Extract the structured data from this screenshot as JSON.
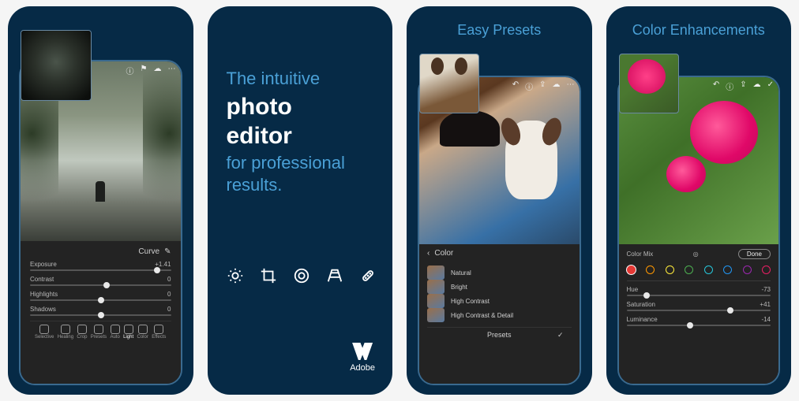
{
  "panel1": {
    "status_icons": [
      "help-icon",
      "flag-icon",
      "cloud-icon",
      "more-icon"
    ],
    "curve_label": "Curve",
    "sliders": [
      {
        "label": "Exposure",
        "value": "+1.41",
        "pos": 88
      },
      {
        "label": "Contrast",
        "value": "0",
        "pos": 52
      },
      {
        "label": "Highlights",
        "value": "0",
        "pos": 48
      },
      {
        "label": "Shadows",
        "value": "0",
        "pos": 48
      }
    ],
    "tools": [
      "Selective",
      "Healing",
      "Crop",
      "Presets",
      "Auto",
      "Light",
      "Color",
      "Effects"
    ],
    "active_tool": "Light"
  },
  "panel2": {
    "line1": "The intuitive",
    "line2": "photo",
    "line3": "editor",
    "line4": "for professional",
    "line5": "results.",
    "brand": "Adobe",
    "tool_icons": [
      "brightness-icon",
      "crop-icon",
      "lens-icon",
      "geometry-icon",
      "healing-icon"
    ]
  },
  "panel3": {
    "title": "Easy Presets",
    "back_label": "Color",
    "presets": [
      "Natural",
      "Bright",
      "High Contrast",
      "High Contrast & Detail"
    ],
    "footer": "Presets"
  },
  "panel4": {
    "title": "Color Enhancements",
    "section": "Color Mix",
    "done": "Done",
    "colors": [
      "#e53935",
      "#ff9800",
      "#ffeb3b",
      "#4caf50",
      "#26c6da",
      "#2196f3",
      "#9c27b0",
      "#e91e63"
    ],
    "selected_color": 0,
    "sliders": [
      {
        "label": "Hue",
        "value": "-73",
        "pos": 12
      },
      {
        "label": "Saturation",
        "value": "+41",
        "pos": 70
      },
      {
        "label": "Luminance",
        "value": "-14",
        "pos": 42
      }
    ]
  }
}
